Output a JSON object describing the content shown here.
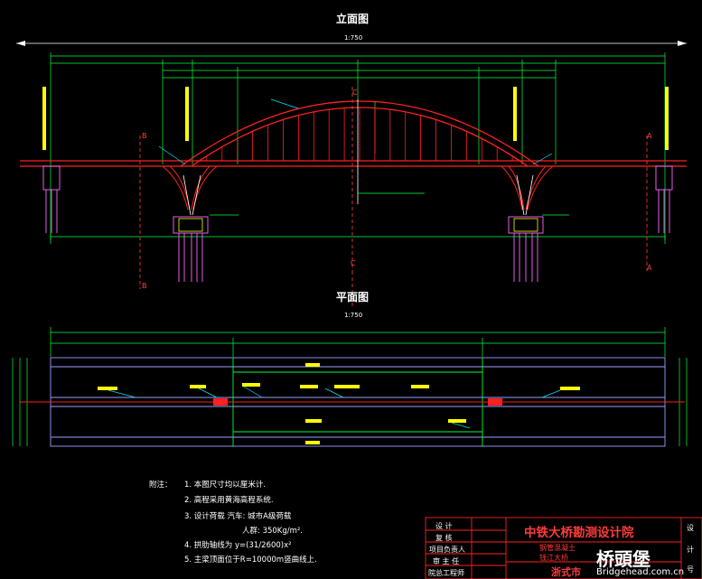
{
  "elevation": {
    "title": "立面图",
    "scale": "1:750"
  },
  "plan": {
    "title": "平面图",
    "scale": "1:750"
  },
  "section_marks": [
    "B",
    "A",
    "C"
  ],
  "notes": {
    "label": "附注：",
    "items": [
      "1. 本图尺寸均以厘米计.",
      "2. 高程采用黄海高程系统.",
      "3. 设计荷载   汽车: 城市A级荷载",
      "人群: 350Kg/m².",
      "4. 拱肋轴线为  y=(31/2600)x²",
      "5. 主梁顶面位于R=10000m竖曲线上."
    ]
  },
  "title_block": {
    "rows": [
      "设 计",
      "复 核",
      "项目负责人",
      "审 主 任",
      "院总工程师"
    ],
    "company": "中铁大桥勘测设计院",
    "project_line1": "钢管混凝土",
    "project_line2": "钱江大桥",
    "city": "浙式市",
    "side_col": [
      "设",
      "计",
      "号"
    ]
  },
  "watermark": {
    "brand": "桥頭堡",
    "url": "Bridgehead.com.cn"
  },
  "colors": {
    "structure": "#ff2020",
    "dimension": "#00ff3c",
    "axis": "#ffff00",
    "piers": "#ff66ff",
    "column": "#ffffff",
    "marker": "#ff4040",
    "leader": "#00e5ff",
    "plan_lines": "#9aa0ff"
  }
}
